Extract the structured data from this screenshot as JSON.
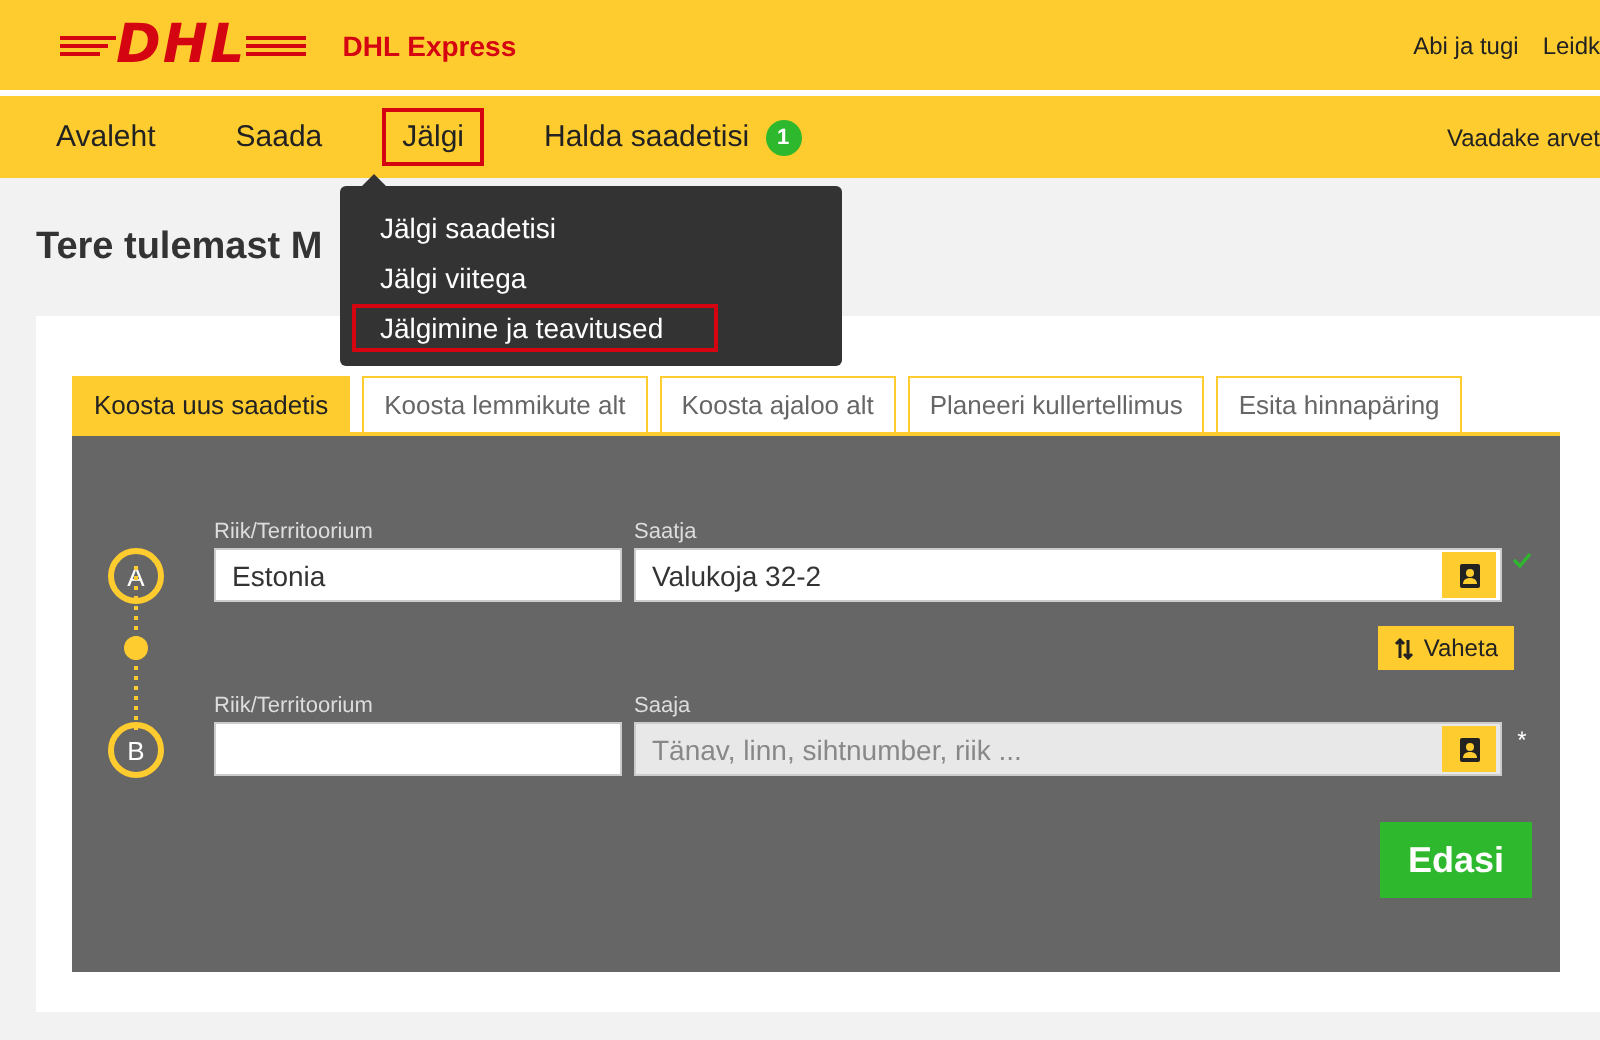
{
  "header": {
    "logo": "DHL",
    "brand": "DHL Express",
    "links": [
      "Abi ja tugi",
      "Leidk"
    ]
  },
  "nav": {
    "items": [
      {
        "label": "Avaleht",
        "selected": false
      },
      {
        "label": "Saada",
        "selected": false
      },
      {
        "label": "Jälgi",
        "selected": true
      },
      {
        "label": "Halda saadetisi",
        "selected": false,
        "badge": "1"
      }
    ],
    "right_link": "Vaadake arvet"
  },
  "dropdown": {
    "items": [
      {
        "label": "Jälgi saadetisi",
        "selected": false
      },
      {
        "label": "Jälgi viitega",
        "selected": false
      },
      {
        "label": "Jälgimine ja teavitused",
        "selected": true
      }
    ]
  },
  "heading": "Tere tulemast M",
  "tabs": [
    {
      "label": "Koosta uus saadetis",
      "selected": true
    },
    {
      "label": "Koosta lemmikute alt",
      "selected": false
    },
    {
      "label": "Koosta ajaloo alt",
      "selected": false
    },
    {
      "label": "Planeeri kullertellimus",
      "selected": false
    },
    {
      "label": "Esita hinnapäring",
      "selected": false
    }
  ],
  "route": [
    {
      "marker": "A",
      "country_label": "Riik/Territoorium",
      "country_value": "Estonia",
      "address_label": "Saatja",
      "address_value": "Valukoja 32-2",
      "validated": true
    },
    {
      "marker": "B",
      "country_label": "Riik/Territoorium",
      "address_label": "Saaja",
      "address_placeholder": "Tänav, linn, sihtnumber, riik ...",
      "validated": false,
      "required_mark": "*"
    }
  ],
  "swap_button": "Vaheta",
  "next_button": "Edasi"
}
